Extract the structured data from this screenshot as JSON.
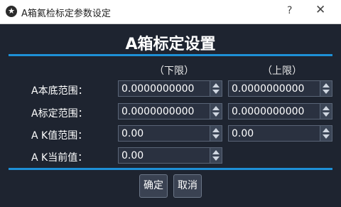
{
  "window": {
    "title": "A箱氦检标定参数设定",
    "help_label": "?",
    "close_label": "✕"
  },
  "dialog": {
    "title": "A箱标定设置",
    "col_lower": "（下限）",
    "col_upper": "（上限）"
  },
  "rows": [
    {
      "label": "A本底范围：",
      "lower": "0.0000000000",
      "upper": "0.0000000000"
    },
    {
      "label": "A标定范围：",
      "lower": "0.0000000000",
      "upper": "0.0000000000"
    },
    {
      "label": "A K值范围：",
      "lower": "0.00",
      "upper": "0.00"
    },
    {
      "label": "A K当前值：",
      "value": "0.00"
    }
  ],
  "buttons": {
    "ok": "确定",
    "cancel": "取消"
  },
  "colors": {
    "background": "#1e2430",
    "accent": "#1e90d6"
  },
  "icons": {
    "app": "app-emblem-icon",
    "spin_up": "spin-up-arrow-icon",
    "spin_down": "spin-down-arrow-icon"
  }
}
